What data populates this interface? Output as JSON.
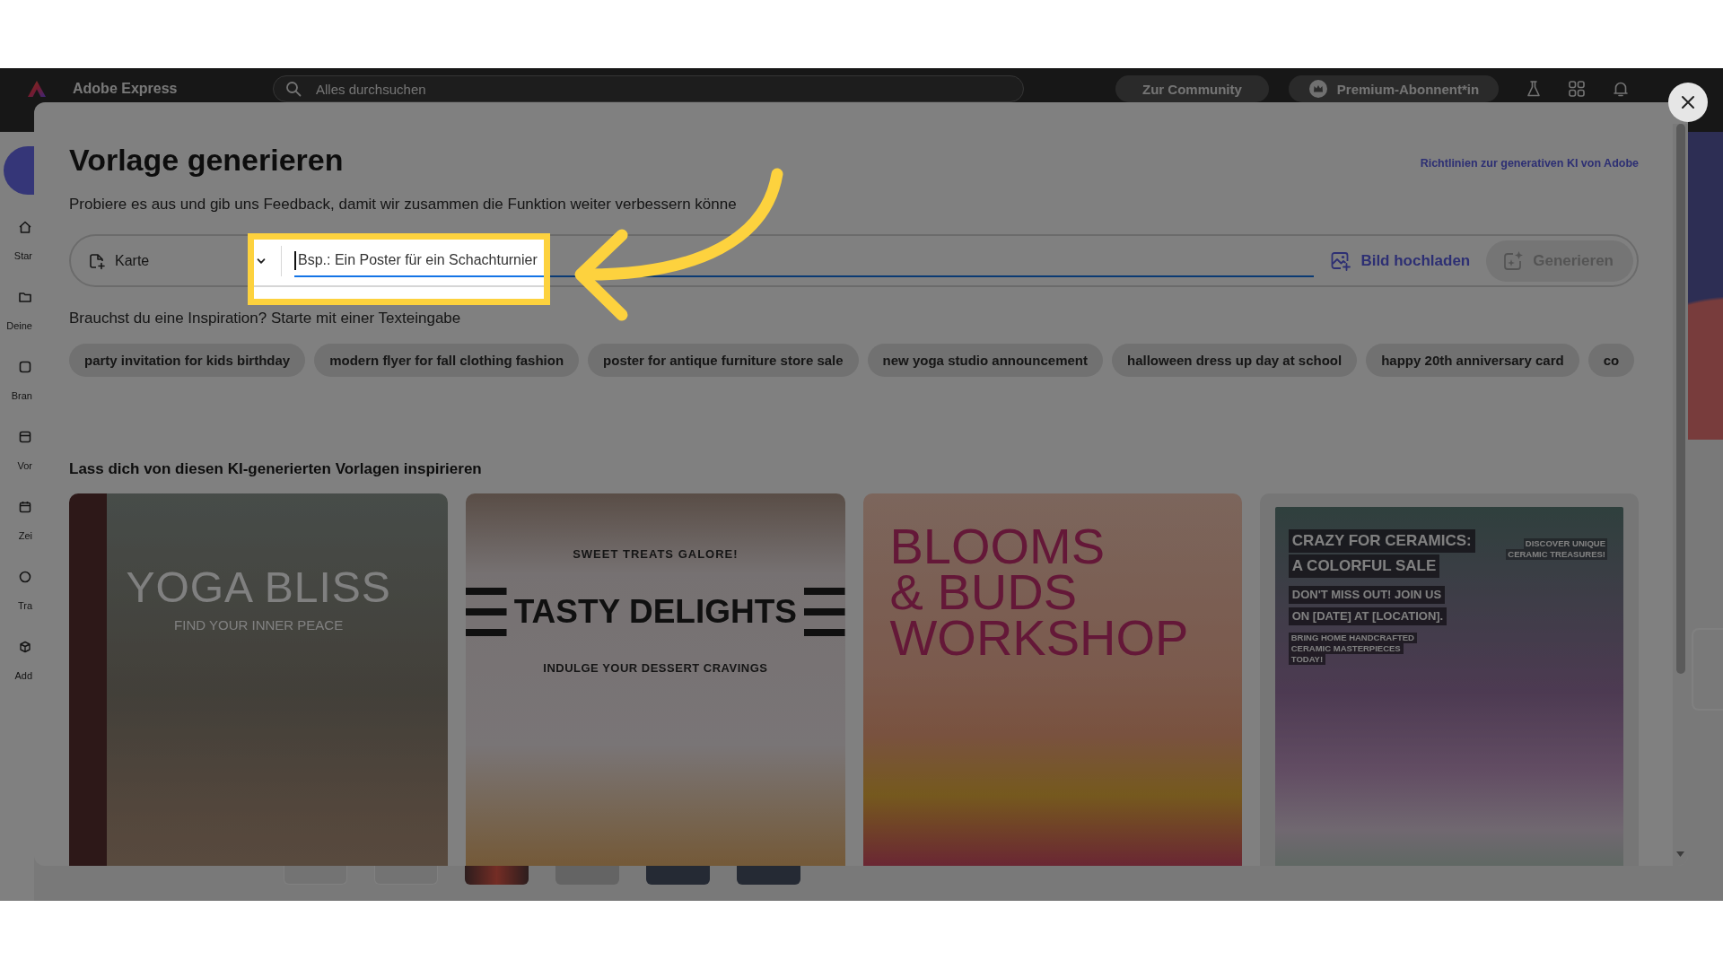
{
  "top_bar": {
    "app_name": "Adobe Express",
    "search": {
      "placeholder": "Alles durchsuchen"
    },
    "buttons": [
      {
        "label": "Zur Community",
        "kind": "plain"
      },
      {
        "label": "Premium-Abonnent*in",
        "kind": "premium"
      }
    ]
  },
  "sidebar": {
    "items": [
      {
        "label": "Star"
      },
      {
        "label": "Deine"
      },
      {
        "label": "Bran"
      },
      {
        "label": "Vor"
      },
      {
        "label": "Zei"
      },
      {
        "label": "Tra"
      },
      {
        "label": "Add"
      }
    ]
  },
  "dialog": {
    "title": "Vorlage generieren",
    "link": "Richtlinien zur generativen KI von Adobe",
    "subtitle": "Probiere es aus und gib uns Feedback, damit wir zusammen die Funktion weiter verbessern könne",
    "prompt": {
      "type": "Karte",
      "placeholder": "Bsp.: Ein Poster für ein Schachturnier",
      "focused": true,
      "upload": "Bild hochladen",
      "generate": {
        "label": "Generieren",
        "disabled": true
      }
    },
    "inspiration": "Brauchst du eine Inspiration? Starte mit einer Texteingabe",
    "suggestions": [
      "party invitation for kids birthday",
      "modern flyer for fall clothing fashion",
      "poster for antique furniture store sale",
      "new yoga studio announcement",
      "halloween dress up day at school",
      "happy 20th anniversary card",
      "co"
    ],
    "gallery_heading": "Lass dich von diesen KI-generierten Vorlagen inspirieren",
    "templates": [
      {
        "kind": "outline",
        "headline": "YOGA BLISS",
        "tagline": "FIND YOUR INNER PEACE"
      },
      {
        "kind": "striped",
        "kicker": "SWEET TREATS GALORE!",
        "headline": "TASTY DELIGHTS",
        "tagline": "INDULGE YOUR DESSERT CRAVINGS"
      },
      {
        "kind": "stacked",
        "lines": [
          "BLOOMS",
          "& BUDS",
          "WORKSHOP"
        ]
      },
      {
        "kind": "framed",
        "headline_lines": [
          "CRAZY FOR CERAMICS:",
          "A COLORFUL SALE"
        ],
        "sublines": [
          "DON'T MISS OUT! JOIN US",
          "ON [DATE] AT [LOCATION]."
        ],
        "notes": [
          "BRING HOME HANDCRAFTED",
          "CERAMIC MASTERPIECES",
          "TODAY!"
        ],
        "corner": [
          "DISCOVER UNIQUE",
          "CERAMIC TREASURES!"
        ]
      }
    ]
  },
  "tutorial": {
    "highlight": true,
    "arrow": true
  }
}
